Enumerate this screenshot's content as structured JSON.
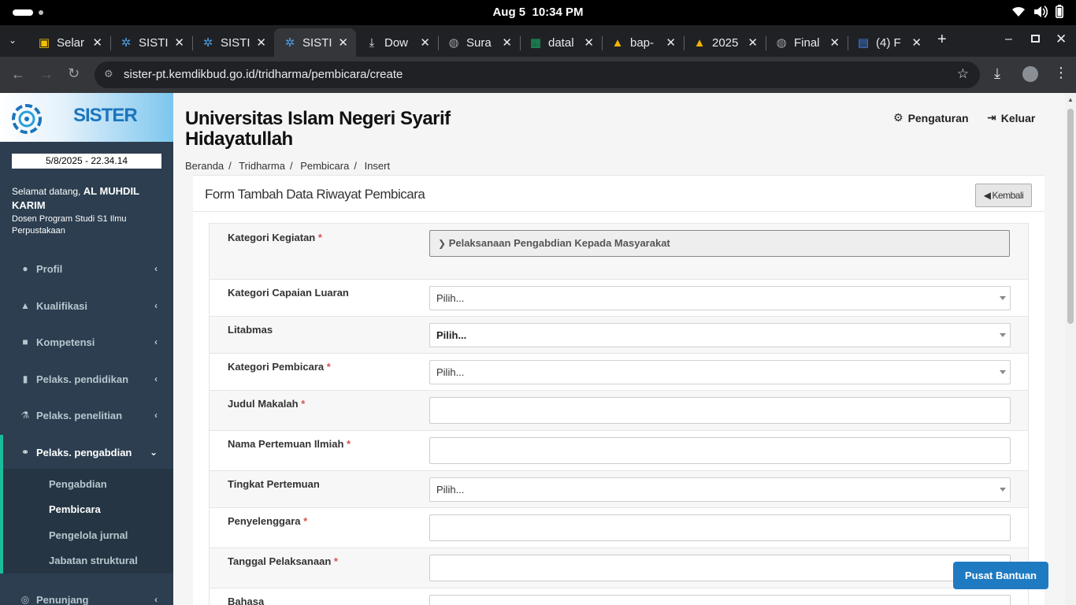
{
  "os": {
    "date": "Aug 5",
    "time": "10:34 PM"
  },
  "tabs": [
    {
      "title": "Selar",
      "icon": "uin-favicon",
      "active": false
    },
    {
      "title": "SISTI",
      "icon": "sister-favicon",
      "active": false
    },
    {
      "title": "SISTI",
      "icon": "sister-favicon",
      "active": false
    },
    {
      "title": "SISTI",
      "icon": "sister-favicon",
      "active": true
    },
    {
      "title": "Dow",
      "icon": "download-icon",
      "active": false
    },
    {
      "title": "Sura",
      "icon": "globe-icon",
      "active": false
    },
    {
      "title": "datal",
      "icon": "sheets-icon",
      "active": false
    },
    {
      "title": "bap-",
      "icon": "drive-icon",
      "active": false
    },
    {
      "title": "2025",
      "icon": "drive-icon",
      "active": false
    },
    {
      "title": "Final",
      "icon": "globe-icon",
      "active": false
    },
    {
      "title": "(4) F",
      "icon": "docs-icon",
      "active": false
    }
  ],
  "address_bar": {
    "url": "sister-pt.kemdikbud.go.id/tridharma/pembicara/create"
  },
  "sidebar": {
    "brand": "SISTER",
    "datetime": "5/8/2025 - 22.34.14",
    "welcome_prefix": "Selamat datang,",
    "user_name": "AL MUHDIL KARIM",
    "user_role": "Dosen Program Studi S1 Ilmu Perpustakaan",
    "menu": [
      {
        "label": "Profil",
        "icon": "user-icon"
      },
      {
        "label": "Kualifikasi",
        "icon": "graduation-cap-icon"
      },
      {
        "label": "Kompetensi",
        "icon": "cubes-icon"
      },
      {
        "label": "Pelaks. pendidikan",
        "icon": "book-icon"
      },
      {
        "label": "Pelaks. penelitian",
        "icon": "flask-icon"
      },
      {
        "label": "Pelaks. pengabdian",
        "icon": "link-icon"
      },
      {
        "label": "Penunjang",
        "icon": "support-icon"
      }
    ],
    "submenu": [
      "Pengabdian",
      "Pembicara",
      "Pengelola jurnal",
      "Jabatan struktural"
    ]
  },
  "header": {
    "university": "Universitas Islam Negeri Syarif Hidayatullah",
    "settings_label": "Pengaturan",
    "logout_label": "Keluar"
  },
  "breadcrumb": [
    "Beranda",
    "Tridharma",
    "Pembicara",
    "Insert"
  ],
  "form": {
    "title": "Form Tambah Data Riwayat Pembicara",
    "back_label": "Kembali",
    "kategori_kegiatan_label": "Kategori Kegiatan",
    "kategori_kegiatan_value": "Pelaksanaan Pengabdian Kepada Masyarakat",
    "kategori_capaian_label": "Kategori Capaian Luaran",
    "kategori_capaian_value": "Pilih...",
    "litabmas_label": "Litabmas",
    "litabmas_value": "Pilih...",
    "kategori_pembicara_label": "Kategori Pembicara",
    "kategori_pembicara_value": "Pilih...",
    "judul_makalah_label": "Judul Makalah",
    "nama_pertemuan_label": "Nama Pertemuan Ilmiah",
    "tingkat_pertemuan_label": "Tingkat Pertemuan",
    "tingkat_pertemuan_value": "Pilih...",
    "penyelenggara_label": "Penyelenggara",
    "tanggal_label": "Tanggal Pelaksanaan",
    "bahasa_label": "Bahasa",
    "required_mark": "*"
  },
  "help_button": "Pusat Bantuan",
  "colors": {
    "sidebar": "#2c3e50",
    "accent": "#1abc9c",
    "brand_blue": "#1c75bc",
    "help": "#1f7bc1"
  }
}
